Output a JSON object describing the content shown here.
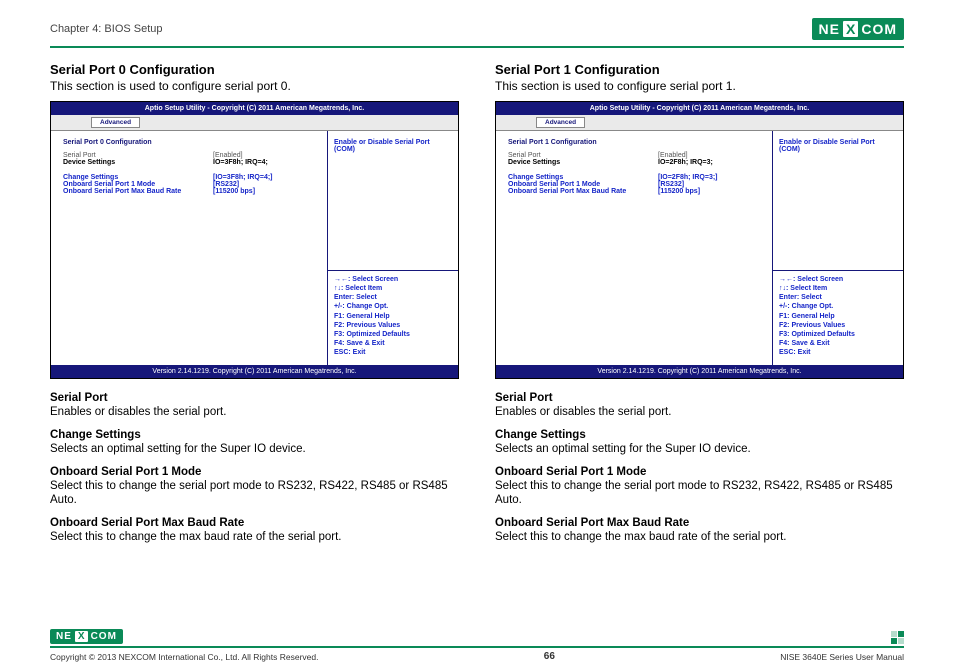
{
  "header": {
    "chapter": "Chapter 4: BIOS Setup",
    "logo_left": "NE",
    "logo_mid": "X",
    "logo_right": "COM"
  },
  "left": {
    "title": "Serial Port 0 Configuration",
    "sub": "This section is used to configure serial port 0.",
    "bios": {
      "titlebar": "Aptio Setup Utility - Copyright (C) 2011 American Megatrends, Inc.",
      "tab": "Advanced",
      "cfg_head": "Serial Port 0 Configuration",
      "serial_port_label": "Serial Port",
      "serial_port_val": "[Enabled]",
      "device_settings_label": "Device Settings",
      "device_settings_val": "IO=3F8h; IRQ=4;",
      "change_settings_label": "Change Settings",
      "change_settings_val": "[IO=3F8h; IRQ=4;]",
      "mode_label": "Onboard Serial Port 1 Mode",
      "mode_val": "[RS232]",
      "baud_label": "Onboard Serial Port Max Baud Rate",
      "baud_val": "[115200 bps]",
      "help_top": "Enable or Disable Serial Port (COM)",
      "nav1": "→←: Select Screen",
      "nav2": "↑↓: Select Item",
      "nav3": "Enter: Select",
      "nav4": "+/-: Change Opt.",
      "nav5": "F1: General Help",
      "nav6": "F2: Previous Values",
      "nav7": "F3: Optimized Defaults",
      "nav8": "F4: Save & Exit",
      "nav9": "ESC: Exit",
      "footer": "Version 2.14.1219. Copyright (C) 2011 American Megatrends, Inc."
    },
    "desc": {
      "d1t": "Serial Port",
      "d1b": "Enables or disables the serial port.",
      "d2t": "Change Settings",
      "d2b": "Selects an optimal setting for the Super IO device.",
      "d3t": "Onboard Serial Port 1 Mode",
      "d3b": "Select this to change the serial port mode to RS232, RS422, RS485 or RS485 Auto.",
      "d4t": "Onboard Serial Port Max Baud Rate",
      "d4b": "Select this to change the max baud rate of the serial port."
    }
  },
  "right": {
    "title": "Serial Port 1 Configuration",
    "sub": "This section is used to configure serial port 1.",
    "bios": {
      "titlebar": "Aptio Setup Utility - Copyright (C) 2011 American Megatrends, Inc.",
      "tab": "Advanced",
      "cfg_head": "Serial Port 1 Configuration",
      "serial_port_label": "Serial Port",
      "serial_port_val": "[Enabled]",
      "device_settings_label": "Device Settings",
      "device_settings_val": "IO=2F8h; IRQ=3;",
      "change_settings_label": "Change Settings",
      "change_settings_val": "[IO=2F8h; IRQ=3;]",
      "mode_label": "Onboard Serial Port 1 Mode",
      "mode_val": "[RS232]",
      "baud_label": "Onboard Serial Port Max Baud Rate",
      "baud_val": "[115200 bps]",
      "help_top": "Enable or Disable Serial Port (COM)",
      "nav1": "→←: Select Screen",
      "nav2": "↑↓: Select Item",
      "nav3": "Enter: Select",
      "nav4": "+/-: Change Opt.",
      "nav5": "F1: General Help",
      "nav6": "F2: Previous Values",
      "nav7": "F3: Optimized Defaults",
      "nav8": "F4: Save & Exit",
      "nav9": "ESC: Exit",
      "footer": "Version 2.14.1219. Copyright (C) 2011 American Megatrends, Inc."
    },
    "desc": {
      "d1t": "Serial Port",
      "d1b": "Enables or disables the serial port.",
      "d2t": "Change Settings",
      "d2b": "Selects an optimal setting for the Super IO device.",
      "d3t": "Onboard Serial Port 1 Mode",
      "d3b": "Select this to change the serial port mode to RS232, RS422, RS485 or RS485 Auto.",
      "d4t": "Onboard Serial Port Max Baud Rate",
      "d4b": "Select this to change the max baud rate of the serial port."
    }
  },
  "footer": {
    "copyright": "Copyright © 2013 NEXCOM International Co., Ltd. All Rights Reserved.",
    "page": "66",
    "manual": "NISE 3640E Series User Manual"
  }
}
